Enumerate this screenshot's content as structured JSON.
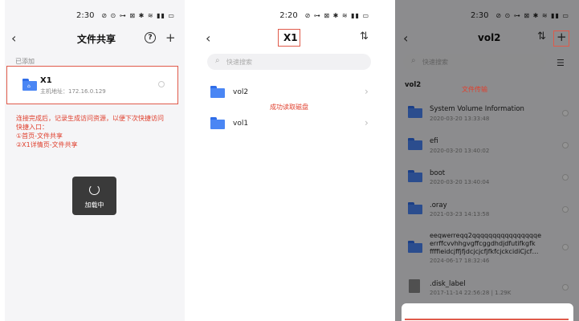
{
  "panel1": {
    "status": {
      "time": "2:30",
      "icons": "⊘ ⊙ ⊶ ⊠ ✱ ≋ ▮▮ ▭"
    },
    "nav": {
      "back": "‹",
      "title": "文件共享",
      "help": "?",
      "add": "+"
    },
    "section_label": "已添加",
    "device": {
      "name": "X1",
      "host": "主机地址：172.16.0.129"
    },
    "annotation": [
      "连接完成后，记录生成访问资源，以便下次快捷访问",
      "快捷入口：",
      "①首页-文件共享",
      "②X1详情页-文件共享"
    ],
    "toast": "加载中"
  },
  "panel2": {
    "status": {
      "time": "2:20",
      "icons": "⊘ ⊶ ⊠ ✱ ≋ ▮▮ ▭"
    },
    "nav": {
      "back": "‹",
      "title": "X1",
      "sort": "⇅"
    },
    "search_placeholder": "快速搜索",
    "items": [
      {
        "label": "vol2"
      },
      {
        "label": "vol1"
      }
    ],
    "annotation": "成功读取磁盘"
  },
  "panel3": {
    "status": {
      "time": "2:30",
      "icons": "⊘ ⊙ ⊶ ⊠ ✱ ≋ ▮▮ ▭"
    },
    "nav": {
      "back": "‹",
      "title": "vol2",
      "sort": "⇅",
      "add": "+"
    },
    "search_placeholder": "快速搜索",
    "path": "vol2",
    "annotation": "文件传输",
    "files": [
      {
        "name": "System Volume Information",
        "date": "2020-03-20 13:33:48",
        "type": "folder"
      },
      {
        "name": "efi",
        "date": "2020-03-20 13:40:02",
        "type": "folder"
      },
      {
        "name": "boot",
        "date": "2020-03-20 13:40:04",
        "type": "folder"
      },
      {
        "name": ".oray",
        "date": "2021-03-23 14:13:58",
        "type": "folder"
      },
      {
        "name": "eeqwerreqq2qqqqqqqqqqqqqqqqe\nerrffcvvhhgvgffcggdhdjdfutifkgfk\nffffieidcjffjfjdcjcjcfjfkfcjckcidiCjcf…",
        "date": "2024-06-17 18:32:46",
        "type": "folder"
      },
      {
        "name": ".disk_label",
        "date": "2017-11-14 22:56:28",
        "size": "1.29K",
        "type": "file"
      }
    ]
  },
  "colors": {
    "accent_red": "#e05a4a",
    "folder_blue": "#4a86f4"
  }
}
